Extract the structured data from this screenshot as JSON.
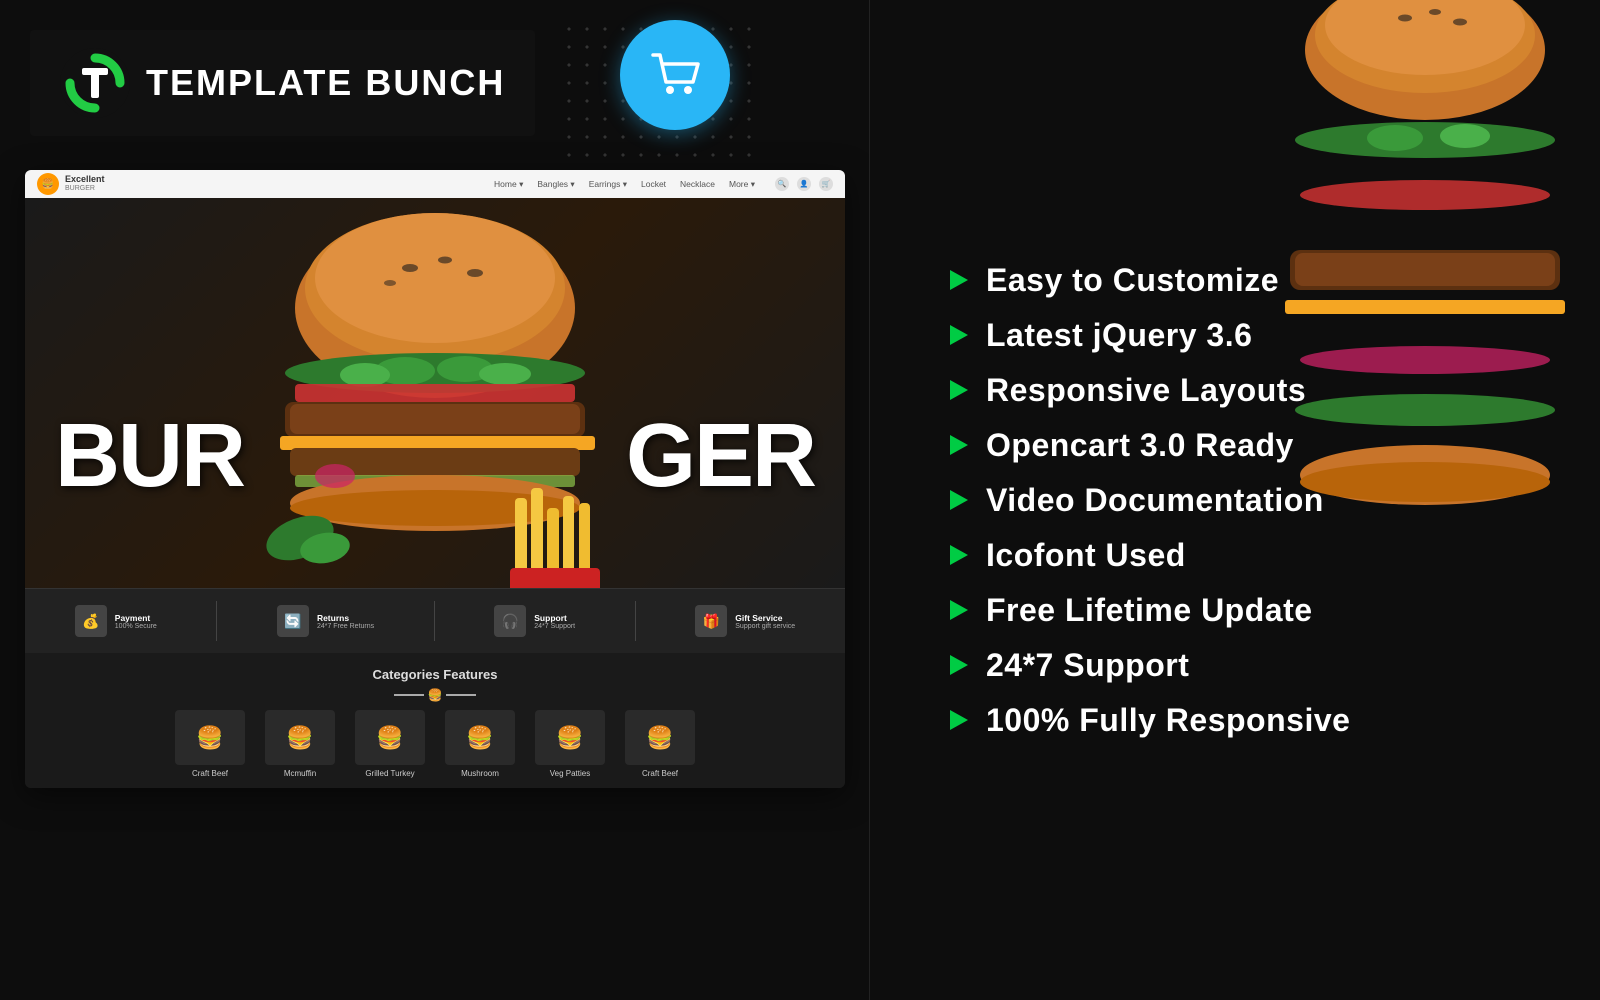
{
  "brand": {
    "name": "TEMPLATE BUNCH"
  },
  "store": {
    "name": "Excellent",
    "subtitle": "BURGER"
  },
  "nav": {
    "links": [
      "Home",
      "Bangles",
      "Earrings",
      "Locket",
      "Necklace",
      "More"
    ]
  },
  "hero": {
    "text_left": "BUR",
    "text_right": "GER"
  },
  "features_bar": [
    {
      "icon": "💰",
      "title": "Payment",
      "sub": "100% Secure"
    },
    {
      "icon": "🔄",
      "title": "Returns",
      "sub": "24*7 Free Returns"
    },
    {
      "icon": "🎧",
      "title": "Support",
      "sub": "24*7 Support"
    },
    {
      "icon": "🎁",
      "title": "Gift Service",
      "sub": "Support gift service"
    }
  ],
  "categories": {
    "title": "Categories Features",
    "items": [
      {
        "label": "Craft Beef",
        "emoji": "🍔"
      },
      {
        "label": "Mcmuffin",
        "emoji": "🍔"
      },
      {
        "label": "Grilled Turkey",
        "emoji": "🍔"
      },
      {
        "label": "Mushroom",
        "emoji": "🍔"
      },
      {
        "label": "Veg Patties",
        "emoji": "🍔"
      },
      {
        "label": "Craft Beef",
        "emoji": "🍔"
      }
    ]
  },
  "feature_list": [
    "Easy to Customize",
    "Latest jQuery 3.6",
    "Responsive Layouts",
    "Opencart 3.0 Ready",
    "Video Documentation",
    "Icofont Used",
    "Free Lifetime Update",
    "24*7 Support",
    "100% Fully Responsive"
  ]
}
